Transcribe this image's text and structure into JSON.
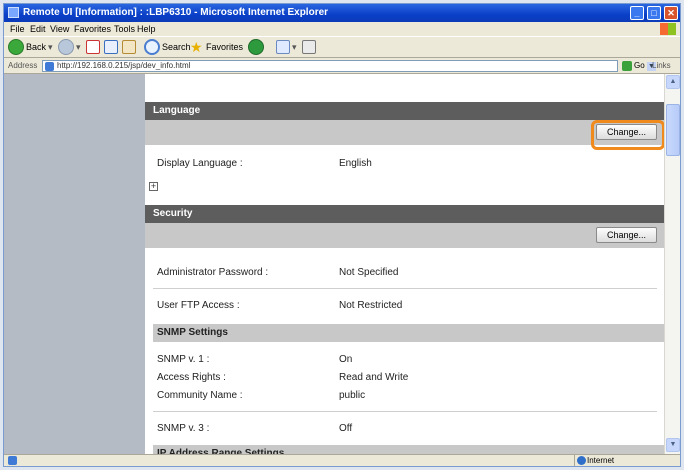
{
  "window": {
    "title": "Remote UI [Information] : :LBP6310 - Microsoft Internet Explorer",
    "controls": {
      "minimize": "_",
      "maximize": "□",
      "close": "✕"
    }
  },
  "menubar": {
    "items": [
      "File",
      "Edit",
      "View",
      "Favorites",
      "Tools",
      "Help"
    ]
  },
  "toolbar": {
    "back": "Back",
    "search": "Search",
    "favorites": "Favorites"
  },
  "address": {
    "label": "Address",
    "url": "http://192.168.0.215/jsp/dev_info.html",
    "go": "Go",
    "links": "Links"
  },
  "language": {
    "heading": "Language",
    "change_label": "Change...",
    "display_language_label": "Display Language :",
    "display_language_value": "English",
    "expand": "+"
  },
  "security": {
    "heading": "Security",
    "change_label": "Change...",
    "admin_password_label": "Administrator Password :",
    "admin_password_value": "Not Specified",
    "user_ftp_label": "User FTP Access :",
    "user_ftp_value": "Not Restricted"
  },
  "snmp": {
    "heading": "SNMP Settings",
    "v1_label": "SNMP v. 1 :",
    "v1_value": "On",
    "access_rights_label": "Access Rights :",
    "access_rights_value": "Read and Write",
    "community_label": "Community Name :",
    "community_value": "public",
    "v3_label": "SNMP v. 3 :",
    "v3_value": "Off"
  },
  "ip_range": {
    "heading": "IP Address Range Settings"
  },
  "statusbar": {
    "zone": "Internet"
  },
  "colors": {
    "highlight": "#f08a1c",
    "section_header": "#5d5d5d",
    "sidebar": "#b4bbc5"
  }
}
